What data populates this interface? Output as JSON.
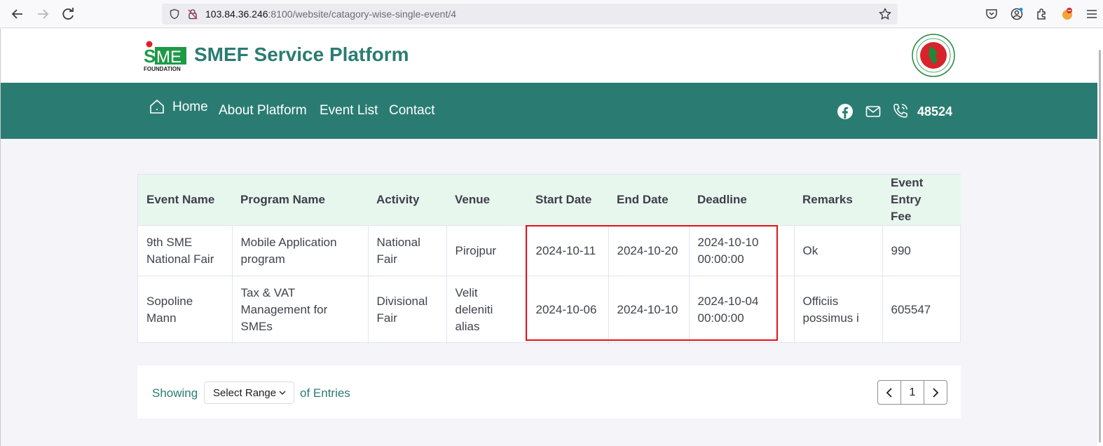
{
  "browser": {
    "url_host": "103.84.36.246",
    "url_rest": ":8100/website/catagory-wise-single-event/4"
  },
  "header": {
    "logo_text_top": "SME",
    "logo_text_bottom": "FOUNDATION",
    "site_title": "SMEF Service Platform"
  },
  "nav": {
    "home": "Home",
    "about": "About Platform",
    "events": "Event List",
    "contact": "Contact",
    "phone": "48524"
  },
  "table": {
    "headers": [
      "Event Name",
      "Program Name",
      "Activity",
      "Venue",
      "Start Date",
      "End Date",
      "Deadline",
      "Remarks",
      "Event Entry Fee"
    ],
    "rows": [
      [
        "9th SME National Fair",
        "Mobile Application program",
        "National Fair",
        "Pirojpur",
        "2024-10-11",
        "2024-10-20",
        "2024-10-10 00:00:00",
        "Ok",
        "990"
      ],
      [
        "Sopoline Mann",
        "Tax & VAT Management for SMEs",
        "Divisional Fair",
        "Velit deleniti alias",
        "2024-10-06",
        "2024-10-10",
        "2024-10-04 00:00:00",
        "Officiis possimus i",
        "605547"
      ]
    ]
  },
  "pagination": {
    "showing": "Showing",
    "select_range": "Select Range",
    "of_entries": "of Entries",
    "current_page": "1"
  },
  "colors": {
    "brand": "#2a7c72",
    "header_row": "#e8f7ee",
    "highlight": "#e3111b"
  }
}
